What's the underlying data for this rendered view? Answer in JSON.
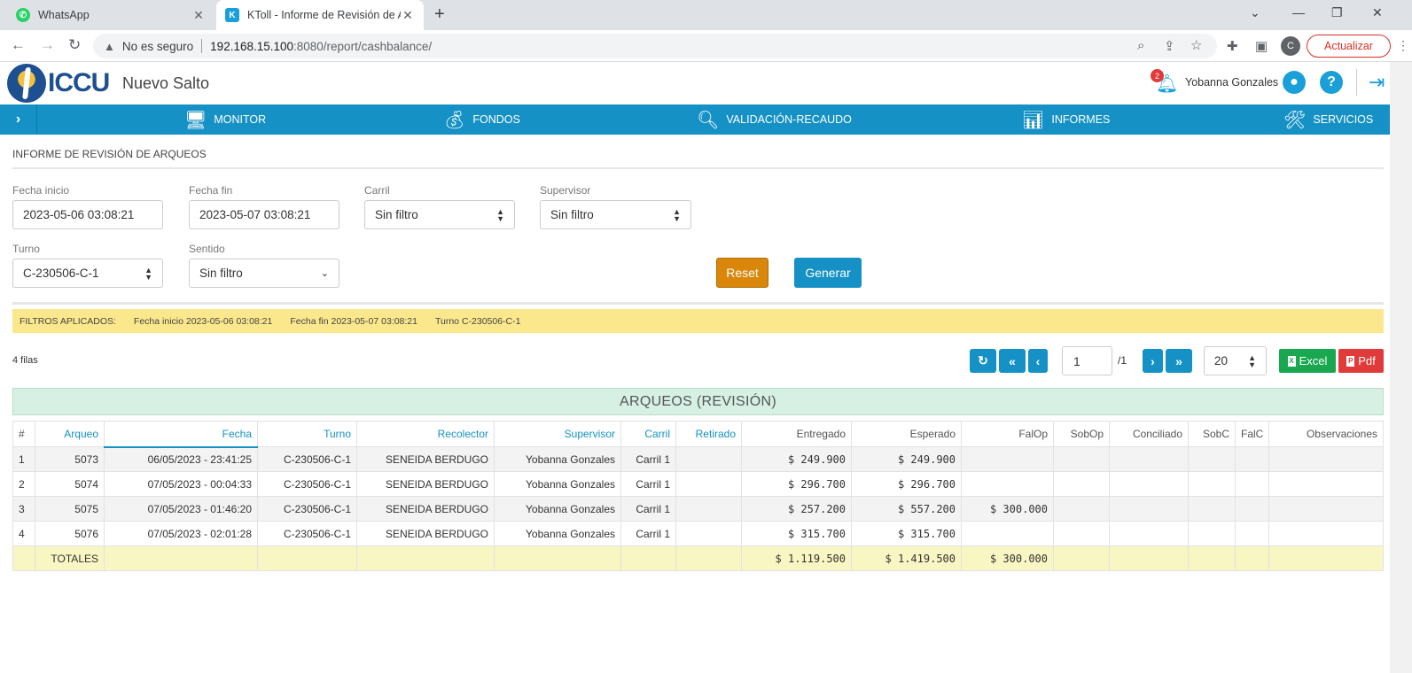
{
  "browser": {
    "tabs": [
      {
        "title": "WhatsApp",
        "favicon": "whatsapp-icon",
        "favicon_letter": "✆"
      },
      {
        "title": "KToll - Informe de Revisión de Ar",
        "favicon": "k-icon",
        "favicon_letter": "K"
      }
    ],
    "not_secure": "No es seguro",
    "url_host": "192.168.15.100",
    "url_rest": ":8080/report/cashbalance/",
    "profile_initial": "C",
    "update_label": "Actualizar"
  },
  "header": {
    "logo_text": "ICCU",
    "site_name": "Nuevo Salto",
    "notifications": "2",
    "username": "Yobanna Gonzales"
  },
  "nav": [
    {
      "label": "MONITOR",
      "icon": "monitor-icon"
    },
    {
      "label": "FONDOS",
      "icon": "money-bag-icon"
    },
    {
      "label": "VALIDACIÓN-RECAUDO",
      "icon": "search-money-icon"
    },
    {
      "label": "INFORMES",
      "icon": "report-icon"
    },
    {
      "label": "SERVICIOS",
      "icon": "tools-icon"
    }
  ],
  "page": {
    "title": "INFORME DE REVISIÓN DE ARQUEOS",
    "filters": {
      "fecha_inicio": {
        "label": "Fecha inicio",
        "value": "2023-05-06 03:08:21"
      },
      "fecha_fin": {
        "label": "Fecha fin",
        "value": "2023-05-07 03:08:21"
      },
      "carril": {
        "label": "Carril",
        "value": "Sin filtro"
      },
      "supervisor": {
        "label": "Supervisor",
        "value": "Sin filtro"
      },
      "turno": {
        "label": "Turno",
        "value": "C-230506-C-1"
      },
      "sentido": {
        "label": "Sentido",
        "value": "Sin filtro"
      }
    },
    "reset_label": "Reset",
    "generate_label": "Generar",
    "applied": {
      "label": "FILTROS APLICADOS:",
      "items": [
        "Fecha inicio 2023-05-06 03:08:21",
        "Fecha fin 2023-05-07 03:08:21",
        "Turno C-230506-C-1"
      ]
    },
    "rows_count": "4 filas",
    "pagination": {
      "current": "1",
      "total": "/1",
      "page_size": "20"
    },
    "excel_label": "Excel",
    "pdf_label": "Pdf"
  },
  "table": {
    "title": "ARQUEOS (REVISIÓN)",
    "columns": [
      "#",
      "Arqueo",
      "Fecha",
      "Turno",
      "Recolector",
      "Supervisor",
      "Carril",
      "Retirado",
      "Entregado",
      "Esperado",
      "FalOp",
      "SobOp",
      "Conciliado",
      "SobC",
      "FalC",
      "Observaciones"
    ],
    "rows": [
      [
        "1",
        "5073",
        "06/05/2023 - 23:41:25",
        "C-230506-C-1",
        "SENEIDA BERDUGO",
        "Yobanna Gonzales",
        "Carril 1",
        "",
        "$ 249.900",
        "$ 249.900",
        "",
        "",
        "",
        "",
        "",
        ""
      ],
      [
        "2",
        "5074",
        "07/05/2023 - 00:04:33",
        "C-230506-C-1",
        "SENEIDA BERDUGO",
        "Yobanna Gonzales",
        "Carril 1",
        "",
        "$ 296.700",
        "$ 296.700",
        "",
        "",
        "",
        "",
        "",
        ""
      ],
      [
        "3",
        "5075",
        "07/05/2023 - 01:46:20",
        "C-230506-C-1",
        "SENEIDA BERDUGO",
        "Yobanna Gonzales",
        "Carril 1",
        "",
        "$ 257.200",
        "$ 557.200",
        "$ 300.000",
        "",
        "",
        "",
        "",
        ""
      ],
      [
        "4",
        "5076",
        "07/05/2023 - 02:01:28",
        "C-230506-C-1",
        "SENEIDA BERDUGO",
        "Yobanna Gonzales",
        "Carril 1",
        "",
        "$ 315.700",
        "$ 315.700",
        "",
        "",
        "",
        "",
        "",
        ""
      ]
    ],
    "totals": {
      "label": "TOTALES",
      "entregado": "$ 1.119.500",
      "esperado": "$ 1.419.500",
      "falop": "$ 300.000"
    }
  },
  "colors": {
    "accent": "#1591c5",
    "reset": "#d9860b",
    "excel": "#19a84f",
    "pdf": "#e03a3a",
    "filters_bg": "#fbe88c",
    "title_bg": "#d6f0e4",
    "totals_bg": "#f8f6c3"
  }
}
